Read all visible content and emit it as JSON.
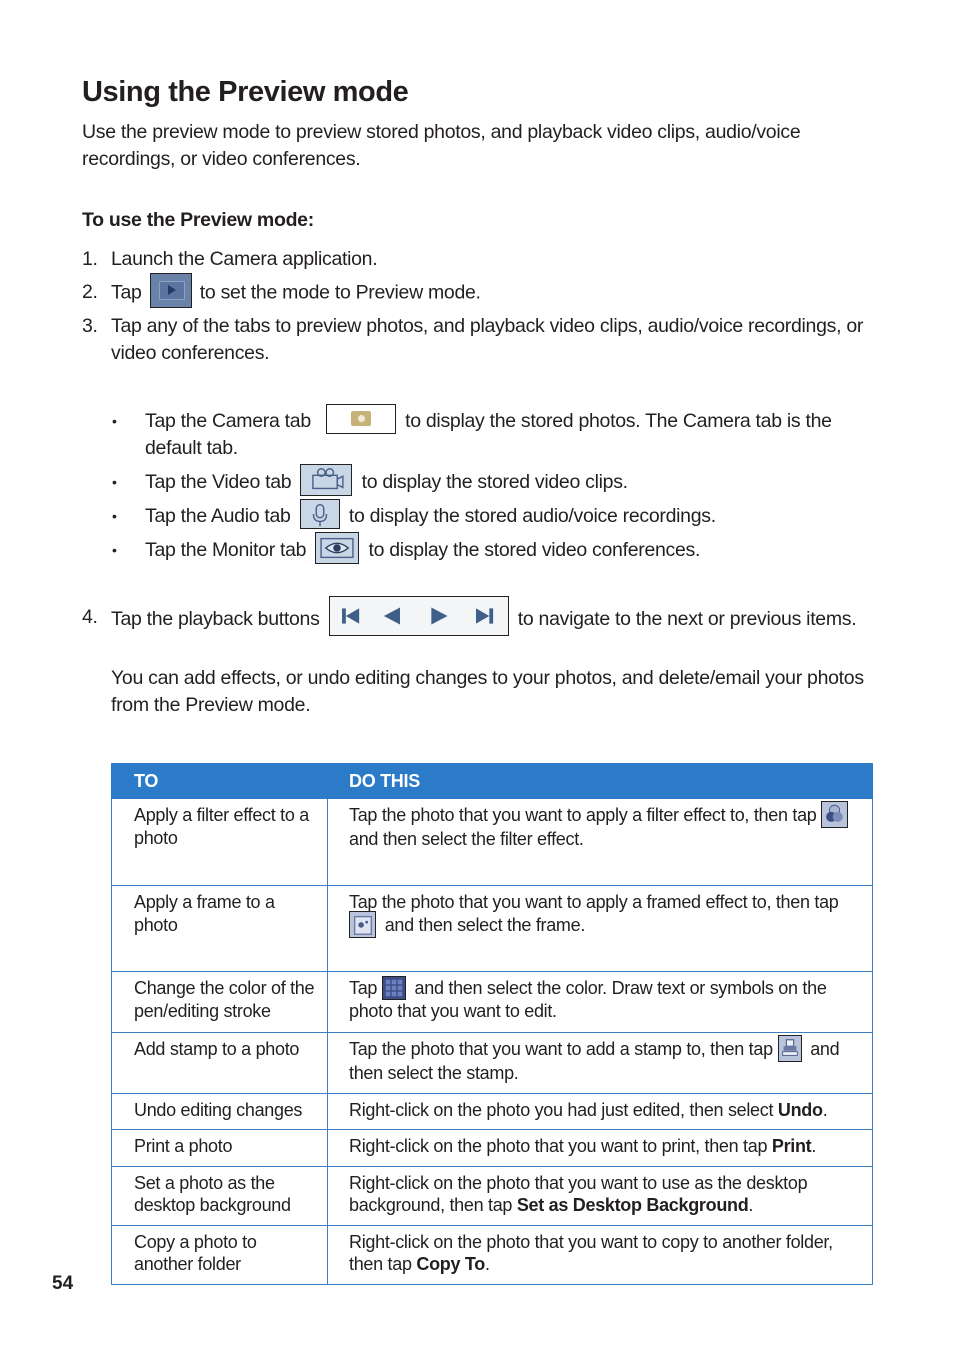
{
  "page": {
    "title": "Using the Preview mode",
    "intro": "Use the preview mode to preview stored photos, and playback video clips, audio/voice recordings, or video conferences.",
    "subheading": "To use the Preview mode:",
    "page_number": "54"
  },
  "steps": [
    {
      "num": "1.",
      "text": "Launch the Camera application."
    },
    {
      "num": "2.",
      "before": "Tap",
      "icon": "preview-mode-icon",
      "after": "to set the mode to Preview mode."
    },
    {
      "num": "3.",
      "text": "Tap any of the tabs to preview photos, and playback video clips, audio/voice recordings, or video conferences."
    },
    {
      "num": "4.",
      "before": "Tap the playback buttons",
      "icon": "playback-buttons-icon",
      "after": "to navigate to the next or previous items."
    }
  ],
  "bullets": [
    {
      "before": "Tap the Camera tab",
      "icon": "camera-tab-icon",
      "after": "to display the stored photos. The Camera tab is the default tab."
    },
    {
      "before": "Tap the Video tab",
      "icon": "video-tab-icon",
      "after": "to display the stored video clips."
    },
    {
      "before": "Tap the Audio tab",
      "icon": "audio-tab-icon",
      "after": "to display the stored audio/voice recordings."
    },
    {
      "before": "Tap the Monitor tab",
      "icon": "monitor-tab-icon",
      "after": "to display the stored video conferences."
    }
  ],
  "bullet_symbol": "•",
  "note": "You can add effects, or undo editing changes to your photos, and delete/email your photos from the Preview mode.",
  "playback_buttons": [
    "first",
    "previous",
    "next",
    "last"
  ],
  "table": {
    "header_color": "#2b7bc8",
    "headers": [
      "TO",
      "DO THIS"
    ],
    "rows": [
      {
        "to": "Apply a filter effect to a photo",
        "do_before": "Tap the photo that you want to apply a filter effect to, then tap",
        "icon": "filter-effect-icon",
        "do_after": "and then select the filter effect."
      },
      {
        "to": "Apply a frame to a photo",
        "do_before": "Tap the photo that you want to apply a framed effect to, then tap",
        "icon": "frame-icon",
        "do_after": "and then select the frame."
      },
      {
        "to": "Change the color of the pen/editing stroke",
        "do_before": "Tap",
        "icon": "color-palette-icon",
        "do_after": "and then select the color. Draw text or symbols on the photo that you want to edit."
      },
      {
        "to": "Add stamp to a photo",
        "do_before": "Tap the photo that you want to add a stamp to, then tap",
        "icon": "stamp-icon",
        "do_after": "and then select the stamp."
      },
      {
        "to": "Undo editing changes",
        "do_before": "Right-click on the photo you had just edited, then select",
        "bold": "Undo",
        "do_after": "."
      },
      {
        "to": "Print a photo",
        "do_before": "Right-click on the photo that you want to print, then tap",
        "bold": "Print",
        "do_after": "."
      },
      {
        "to": "Set a photo as the desktop background",
        "do_before": "Right-click on the photo that you want to use as the desktop background, then tap",
        "bold": "Set as Desktop Background",
        "do_after": "."
      },
      {
        "to": "Copy a photo to another folder",
        "do_before": "Right-click on the photo that you want to copy to another folder, then tap",
        "bold": "Copy To",
        "do_after": "."
      }
    ]
  }
}
